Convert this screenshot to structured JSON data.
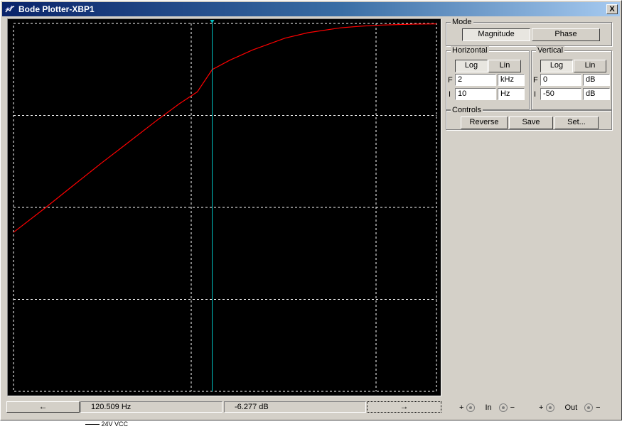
{
  "window": {
    "title": "Bode Plotter-XBP1",
    "close_label": "X"
  },
  "chart_data": {
    "type": "line",
    "title": "",
    "xscale": "log",
    "xlim": [
      10,
      2000
    ],
    "ylim": [
      -50,
      0
    ],
    "grid": true,
    "series": [
      {
        "color": "#ff0000",
        "x": [
          10,
          15,
          20,
          30,
          40,
          60,
          80,
          100,
          120.509,
          150,
          200,
          300,
          400,
          600,
          800,
          1000,
          1500,
          2000
        ],
        "y": [
          -28.4,
          -25.0,
          -22.5,
          -19.0,
          -16.6,
          -13.2,
          -10.9,
          -9.3,
          -6.277,
          -5.0,
          -3.6,
          -2.0,
          -1.25,
          -0.6,
          -0.35,
          -0.22,
          -0.1,
          -0.06
        ]
      }
    ],
    "cursor": {
      "x": 120.509,
      "color": "#00c0c0"
    }
  },
  "mode": {
    "label": "Mode",
    "magnitude_label": "Magnitude",
    "phase_label": "Phase",
    "selected": "Magnitude"
  },
  "horizontal": {
    "label": "Horizontal",
    "log_label": "Log",
    "lin_label": "Lin",
    "selected": "Log",
    "f_label": "F",
    "f_value": "2",
    "f_unit": "kHz",
    "i_label": "I",
    "i_value": "10",
    "i_unit": "Hz"
  },
  "vertical": {
    "label": "Vertical",
    "log_label": "Log",
    "lin_label": "Lin",
    "selected": "Log",
    "f_label": "F",
    "f_value": "0",
    "f_unit": "dB",
    "i_label": "I",
    "i_value": "-50",
    "i_unit": "dB"
  },
  "controls": {
    "label": "Controls",
    "reverse_label": "Reverse",
    "save_label": "Save",
    "set_label": "Set..."
  },
  "status": {
    "frequency_readout": "120.509  Hz",
    "magnitude_readout": "-6.277 dB",
    "left_arrow": "←",
    "right_arrow": "→"
  },
  "terminals": {
    "in_label": "In",
    "out_label": "Out",
    "plus": "+",
    "minus": "−"
  },
  "background_text": "24V  VCC"
}
